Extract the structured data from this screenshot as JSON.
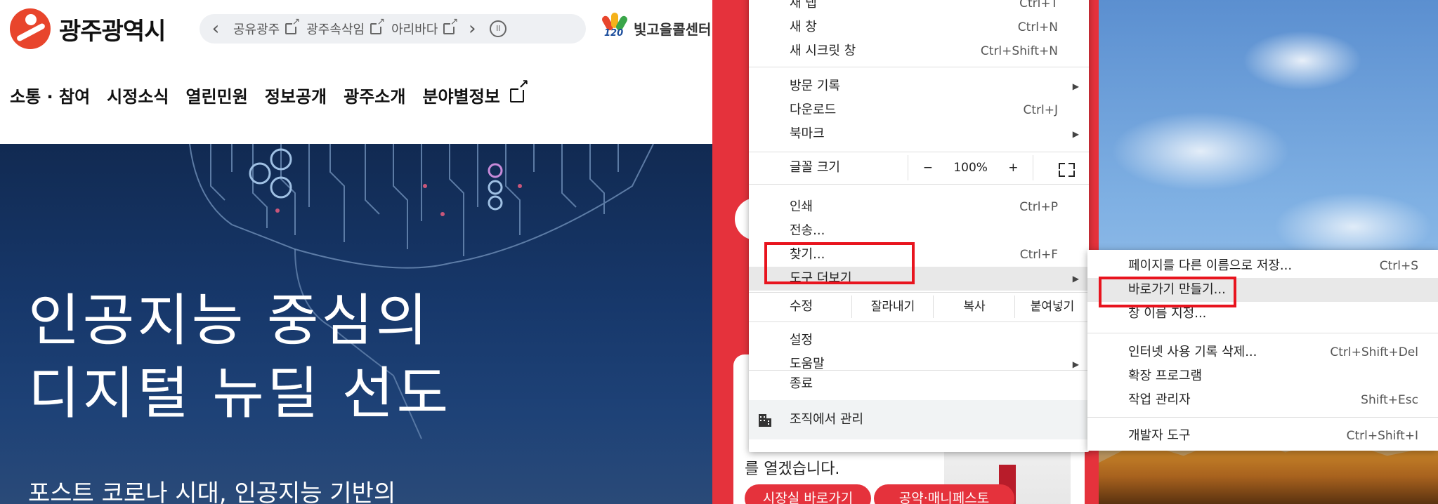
{
  "site": {
    "logo_text": "광주광역시",
    "quicklinks": [
      "공유광주",
      "광주속삭임",
      "아리바다"
    ],
    "quicklink_prev": "‹",
    "quicklink_next": "›",
    "quicklink_pause": "II",
    "callcenter_num": "120",
    "callcenter_text": "빛고을콜센터",
    "nav": [
      "소통 · 참여",
      "시정소식",
      "열린민원",
      "정보공개",
      "광주소개",
      "분야별정보"
    ],
    "hero_line1": "인공지능 중심의",
    "hero_line2": "디지털 뉴딜 선도",
    "hero_sub": "포스트 코로나 시대, 인공지능 기반의"
  },
  "mid_page": {
    "text": "를 열겠습니다.",
    "btn1": "시장실 바로가기",
    "btn2": "공약·매니페스토"
  },
  "menu": {
    "items_top": [
      {
        "label": "새 탭",
        "shortcut": "Ctrl+T"
      },
      {
        "label": "새 창",
        "shortcut": "Ctrl+N"
      },
      {
        "label": "새 시크릿 창",
        "shortcut": "Ctrl+Shift+N"
      }
    ],
    "items_history": [
      {
        "label": "방문 기록",
        "shortcut": "",
        "arrow": "▶"
      },
      {
        "label": "다운로드",
        "shortcut": "Ctrl+J",
        "arrow": ""
      },
      {
        "label": "북마크",
        "shortcut": "",
        "arrow": "▶"
      }
    ],
    "zoom": {
      "label": "글꼴 크기",
      "minus": "−",
      "value": "100%",
      "plus": "+"
    },
    "items_tools": [
      {
        "label": "인쇄",
        "shortcut": "Ctrl+P",
        "arrow": ""
      },
      {
        "label": "전송...",
        "shortcut": "",
        "arrow": ""
      },
      {
        "label": "찾기...",
        "shortcut": "Ctrl+F",
        "arrow": ""
      },
      {
        "label": "도구 더보기",
        "shortcut": "",
        "arrow": "▶"
      }
    ],
    "edit": {
      "label": "수정",
      "cut": "잘라내기",
      "copy": "복사",
      "paste": "붙여넣기"
    },
    "items_settings": [
      {
        "label": "설정",
        "shortcut": "",
        "arrow": ""
      },
      {
        "label": "도움말",
        "shortcut": "",
        "arrow": "▶"
      }
    ],
    "exit": "종료",
    "managed": "조직에서 관리"
  },
  "submenu": {
    "items": [
      {
        "label": "페이지를 다른 이름으로 저장...",
        "shortcut": "Ctrl+S"
      },
      {
        "label": "바로가기 만들기...",
        "shortcut": ""
      },
      {
        "label": "창 이름 지정...",
        "shortcut": ""
      },
      {
        "label": "인터넷 사용 기록 삭제...",
        "shortcut": "Ctrl+Shift+Del"
      },
      {
        "label": "확장 프로그램",
        "shortcut": ""
      },
      {
        "label": "작업 관리자",
        "shortcut": "Shift+Esc"
      },
      {
        "label": "개발자 도구",
        "shortcut": "Ctrl+Shift+I"
      }
    ]
  },
  "colors": {
    "highlight_box": "#e8141e",
    "site_red": "#e5323c",
    "hero_navy": "#17386b"
  }
}
